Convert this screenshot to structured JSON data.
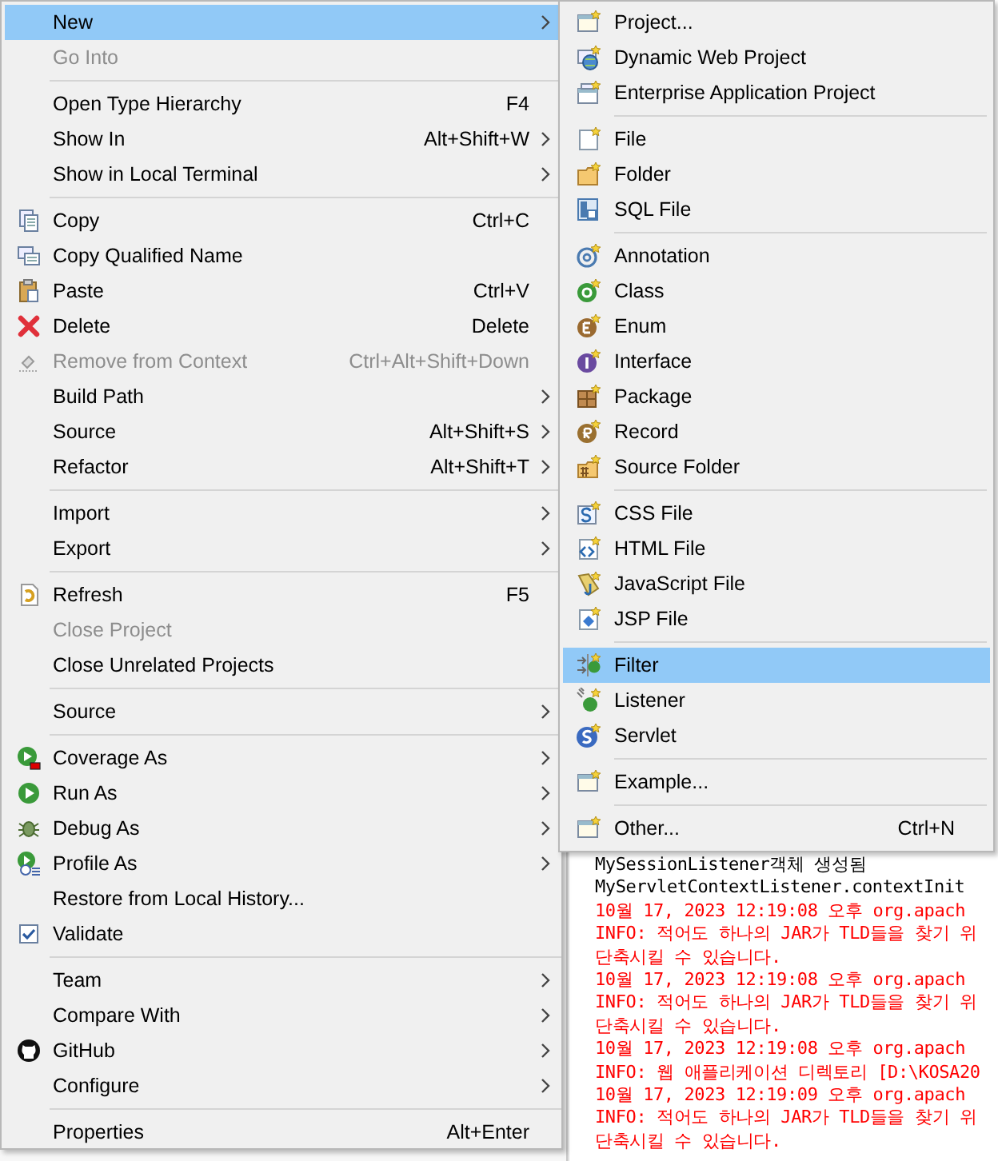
{
  "context_menu": {
    "items": [
      {
        "kind": "item",
        "label": "New",
        "submenu": true,
        "selected": true,
        "disabled": false
      },
      {
        "kind": "item",
        "label": "Go Into",
        "submenu": false,
        "selected": false,
        "disabled": true
      },
      {
        "kind": "separator"
      },
      {
        "kind": "item",
        "label": "Open Type Hierarchy",
        "shortcut": "F4",
        "submenu": false,
        "selected": false,
        "disabled": false
      },
      {
        "kind": "item",
        "label": "Show In",
        "shortcut": "Alt+Shift+W",
        "submenu": true,
        "selected": false,
        "disabled": false
      },
      {
        "kind": "item",
        "label": "Show in Local Terminal",
        "submenu": true,
        "selected": false,
        "disabled": false
      },
      {
        "kind": "separator"
      },
      {
        "kind": "item",
        "label": "Copy",
        "shortcut": "Ctrl+C",
        "submenu": false,
        "selected": false,
        "disabled": false
      },
      {
        "kind": "item",
        "label": "Copy Qualified Name",
        "submenu": false,
        "selected": false,
        "disabled": false
      },
      {
        "kind": "item",
        "label": "Paste",
        "shortcut": "Ctrl+V",
        "submenu": false,
        "selected": false,
        "disabled": false
      },
      {
        "kind": "item",
        "label": "Delete",
        "shortcut": "Delete",
        "submenu": false,
        "selected": false,
        "disabled": false
      },
      {
        "kind": "item",
        "label": "Remove from Context",
        "shortcut": "Ctrl+Alt+Shift+Down",
        "submenu": false,
        "selected": false,
        "disabled": true
      },
      {
        "kind": "item",
        "label": "Build Path",
        "submenu": true,
        "selected": false,
        "disabled": false
      },
      {
        "kind": "item",
        "label": "Source",
        "shortcut": "Alt+Shift+S",
        "submenu": true,
        "selected": false,
        "disabled": false
      },
      {
        "kind": "item",
        "label": "Refactor",
        "shortcut": "Alt+Shift+T",
        "submenu": true,
        "selected": false,
        "disabled": false
      },
      {
        "kind": "separator"
      },
      {
        "kind": "item",
        "label": "Import",
        "submenu": true,
        "selected": false,
        "disabled": false
      },
      {
        "kind": "item",
        "label": "Export",
        "submenu": true,
        "selected": false,
        "disabled": false
      },
      {
        "kind": "separator"
      },
      {
        "kind": "item",
        "label": "Refresh",
        "shortcut": "F5",
        "submenu": false,
        "selected": false,
        "disabled": false
      },
      {
        "kind": "item",
        "label": "Close Project",
        "submenu": false,
        "selected": false,
        "disabled": true
      },
      {
        "kind": "item",
        "label": "Close Unrelated Projects",
        "submenu": false,
        "selected": false,
        "disabled": false
      },
      {
        "kind": "separator"
      },
      {
        "kind": "item",
        "label": "Source",
        "submenu": true,
        "selected": false,
        "disabled": false
      },
      {
        "kind": "separator"
      },
      {
        "kind": "item",
        "label": "Coverage As",
        "submenu": true,
        "selected": false,
        "disabled": false
      },
      {
        "kind": "item",
        "label": "Run As",
        "submenu": true,
        "selected": false,
        "disabled": false
      },
      {
        "kind": "item",
        "label": "Debug As",
        "submenu": true,
        "selected": false,
        "disabled": false
      },
      {
        "kind": "item",
        "label": "Profile As",
        "submenu": true,
        "selected": false,
        "disabled": false
      },
      {
        "kind": "item",
        "label": "Restore from Local History...",
        "submenu": false,
        "selected": false,
        "disabled": false
      },
      {
        "kind": "item",
        "label": "Validate",
        "submenu": false,
        "selected": false,
        "disabled": false
      },
      {
        "kind": "separator"
      },
      {
        "kind": "item",
        "label": "Team",
        "submenu": true,
        "selected": false,
        "disabled": false
      },
      {
        "kind": "item",
        "label": "Compare With",
        "submenu": true,
        "selected": false,
        "disabled": false
      },
      {
        "kind": "item",
        "label": "GitHub",
        "submenu": true,
        "selected": false,
        "disabled": false
      },
      {
        "kind": "item",
        "label": "Configure",
        "submenu": true,
        "selected": false,
        "disabled": false
      },
      {
        "kind": "separator"
      },
      {
        "kind": "item",
        "label": "Properties",
        "shortcut": "Alt+Enter",
        "submenu": false,
        "selected": false,
        "disabled": false
      }
    ]
  },
  "new_submenu": {
    "items": [
      {
        "kind": "item",
        "label": "Project...",
        "selected": false
      },
      {
        "kind": "item",
        "label": "Dynamic Web Project",
        "selected": false
      },
      {
        "kind": "item",
        "label": "Enterprise Application Project",
        "selected": false
      },
      {
        "kind": "separator"
      },
      {
        "kind": "item",
        "label": "File",
        "selected": false
      },
      {
        "kind": "item",
        "label": "Folder",
        "selected": false
      },
      {
        "kind": "item",
        "label": "SQL File",
        "selected": false
      },
      {
        "kind": "separator"
      },
      {
        "kind": "item",
        "label": "Annotation",
        "selected": false
      },
      {
        "kind": "item",
        "label": "Class",
        "selected": false
      },
      {
        "kind": "item",
        "label": "Enum",
        "selected": false
      },
      {
        "kind": "item",
        "label": "Interface",
        "selected": false
      },
      {
        "kind": "item",
        "label": "Package",
        "selected": false
      },
      {
        "kind": "item",
        "label": "Record",
        "selected": false
      },
      {
        "kind": "item",
        "label": "Source Folder",
        "selected": false
      },
      {
        "kind": "separator"
      },
      {
        "kind": "item",
        "label": "CSS File",
        "selected": false
      },
      {
        "kind": "item",
        "label": "HTML File",
        "selected": false
      },
      {
        "kind": "item",
        "label": "JavaScript File",
        "selected": false
      },
      {
        "kind": "item",
        "label": "JSP File",
        "selected": false
      },
      {
        "kind": "separator"
      },
      {
        "kind": "item",
        "label": "Filter",
        "selected": true
      },
      {
        "kind": "item",
        "label": "Listener",
        "selected": false
      },
      {
        "kind": "item",
        "label": "Servlet",
        "selected": false
      },
      {
        "kind": "separator"
      },
      {
        "kind": "item",
        "label": "Example...",
        "selected": false
      },
      {
        "kind": "separator"
      },
      {
        "kind": "item",
        "label": "Other...",
        "shortcut": "Ctrl+N",
        "selected": false
      }
    ]
  },
  "console": {
    "lines": [
      {
        "text": "MySessionListener객체 생성됨",
        "color": "#000000"
      },
      {
        "text": "MyServletContextListener.contextInit",
        "color": "#000000"
      },
      {
        "text": "10월 17, 2023 12:19:08 오후 org.apach",
        "color": "#ff0000"
      },
      {
        "text": "INFO: 적어도 하나의 JAR가 TLD들을 찾기 위",
        "color": "#ff0000"
      },
      {
        "text": "단축시킬 수 있습니다.",
        "color": "#ff0000"
      },
      {
        "text": "10월 17, 2023 12:19:08 오후 org.apach",
        "color": "#ff0000"
      },
      {
        "text": "INFO: 적어도 하나의 JAR가 TLD들을 찾기 위",
        "color": "#ff0000"
      },
      {
        "text": "단축시킬 수 있습니다.",
        "color": "#ff0000"
      },
      {
        "text": "10월 17, 2023 12:19:08 오후 org.apach",
        "color": "#ff0000"
      },
      {
        "text": "INFO: 웹 애플리케이션 디렉토리 [D:\\KOSA20",
        "color": "#ff0000"
      },
      {
        "text": "10월 17, 2023 12:19:09 오후 org.apach",
        "color": "#ff0000"
      },
      {
        "text": "INFO: 적어도 하나의 JAR가 TLD들을 찾기 위",
        "color": "#ff0000"
      },
      {
        "text": "단축시킬 수 있습니다.",
        "color": "#ff0000"
      }
    ]
  }
}
